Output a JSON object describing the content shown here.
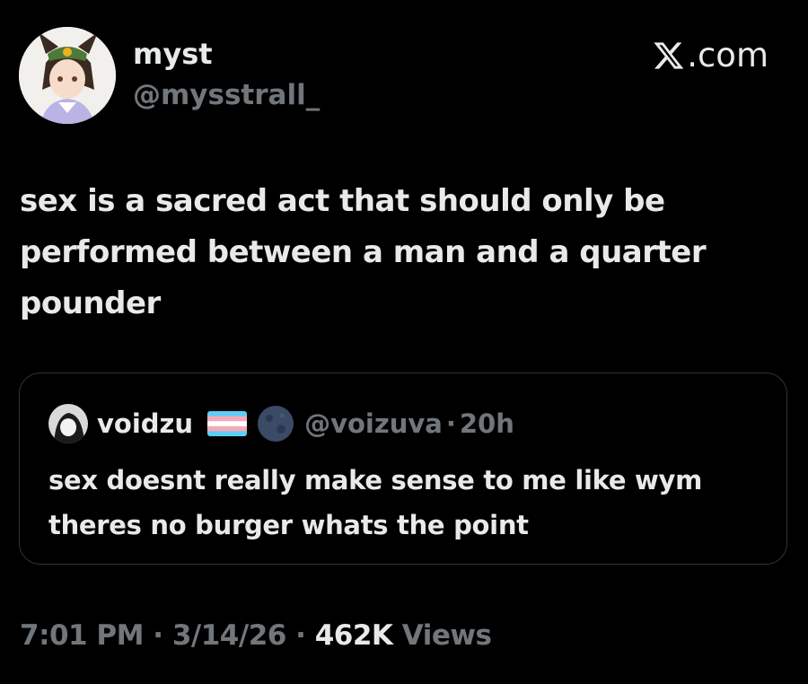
{
  "author": {
    "display_name": "myst",
    "handle": "@mysstrall_"
  },
  "brand": {
    "label": ".com",
    "icon": "x-logo-icon"
  },
  "tweet": {
    "line1": "sex is a sacred act that should only be",
    "line2": "performed between a man and a quarter",
    "line3": "pounder"
  },
  "quote": {
    "display_name": "voidzu",
    "flag_icon": "trans-flag-icon",
    "moon_icon": "new-moon-icon",
    "handle": "@voizuva",
    "separator": "·",
    "time": "20h",
    "line1": "sex doesnt really make sense to me like wym",
    "line2": "theres no burger whats the point"
  },
  "meta": {
    "time": "7:01 PM",
    "sep1": "·",
    "date": "3/14/26",
    "sep2": "·",
    "views_count": "462K",
    "views_label": "Views"
  },
  "colors": {
    "background": "#000000",
    "text": "#e7e9ea",
    "secondary": "#71767b",
    "border": "#2f3336"
  }
}
